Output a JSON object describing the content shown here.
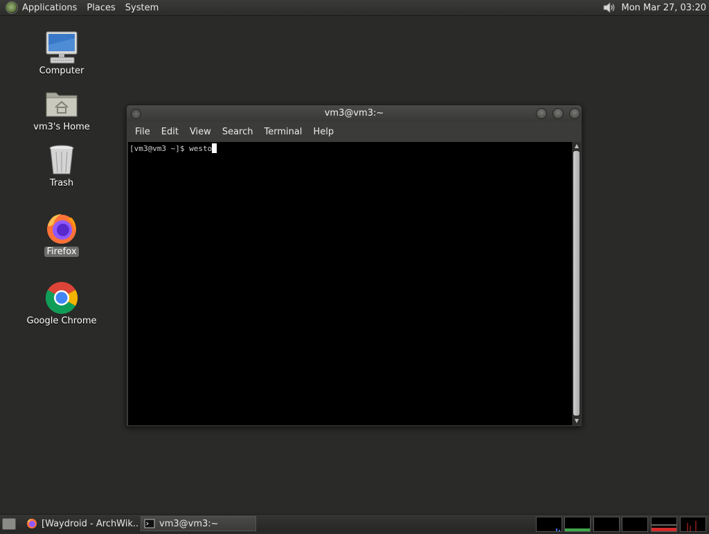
{
  "top_panel": {
    "menus": [
      "Applications",
      "Places",
      "System"
    ],
    "clock": "Mon Mar 27, 03:20",
    "icons": {
      "logo": "distro-logo-icon",
      "volume": "volume-icon"
    }
  },
  "desktop": {
    "icons": [
      {
        "label": "Computer",
        "icon": "computer-icon"
      },
      {
        "label": "vm3's Home",
        "icon": "home-folder-icon"
      },
      {
        "label": "Trash",
        "icon": "trash-icon"
      },
      {
        "label": "Firefox",
        "icon": "firefox-icon",
        "selected": true
      },
      {
        "label": "Google Chrome",
        "icon": "chrome-icon"
      }
    ]
  },
  "terminal": {
    "title": "vm3@vm3:~",
    "menus": [
      "File",
      "Edit",
      "View",
      "Search",
      "Terminal",
      "Help"
    ],
    "prompt": "[vm3@vm3 ~]$ ",
    "input": "westo"
  },
  "taskbar": {
    "tasks": [
      {
        "label": "[Waydroid - ArchWik...",
        "icon": "firefox-icon",
        "active": false
      },
      {
        "label": "vm3@vm3:~",
        "icon": "terminal-icon",
        "active": true
      }
    ],
    "monitors": [
      "cpu-monitor",
      "memory-monitor",
      "network-monitor",
      "swap-monitor",
      "load-monitor",
      "disk-monitor"
    ]
  },
  "colors": {
    "desktop_bg": "#2a2a28",
    "terminal_bg": "#000000",
    "panel_bg": "#2c2c2a"
  }
}
